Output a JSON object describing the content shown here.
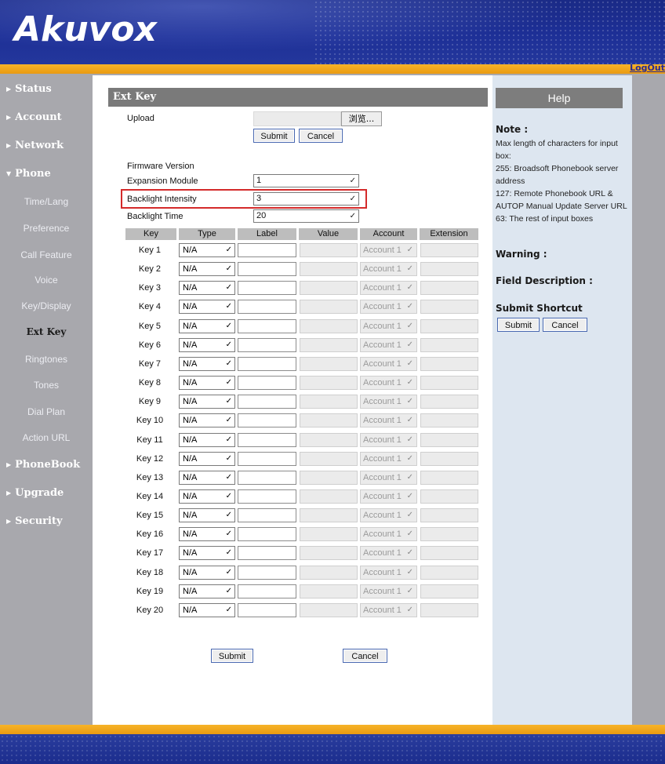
{
  "header": {
    "logo": "Akuvox",
    "logout": "LogOut"
  },
  "sidebar": {
    "sections": [
      {
        "label": "Status"
      },
      {
        "label": "Account"
      },
      {
        "label": "Network"
      },
      {
        "label": "Phone"
      },
      {
        "label": "PhoneBook"
      },
      {
        "label": "Upgrade"
      },
      {
        "label": "Security"
      }
    ],
    "phone_items": [
      {
        "label": "Time/Lang"
      },
      {
        "label": "Preference"
      },
      {
        "label": "Call Feature"
      },
      {
        "label": "Voice"
      },
      {
        "label": "Key/Display"
      },
      {
        "label": "Ext Key"
      },
      {
        "label": "Ringtones"
      },
      {
        "label": "Tones"
      },
      {
        "label": "Dial Plan"
      },
      {
        "label": "Action URL"
      }
    ],
    "active": "Ext Key"
  },
  "main": {
    "title": "Ext Key",
    "upload": {
      "label": "Upload",
      "browse": "浏览...",
      "submit": "Submit",
      "cancel": "Cancel"
    },
    "firmware_label": "Firmware Version",
    "expansion_module": {
      "label": "Expansion Module",
      "value": "1"
    },
    "backlight_intensity": {
      "label": "Backlight Intensity",
      "value": "3"
    },
    "backlight_time": {
      "label": "Backlight Time",
      "value": "20"
    },
    "table": {
      "headers": [
        "Key",
        "Type",
        "Label",
        "Value",
        "Account",
        "Extension"
      ],
      "rows": [
        {
          "key": "Key 1",
          "type": "N/A",
          "account": "Account 1"
        },
        {
          "key": "Key 2",
          "type": "N/A",
          "account": "Account 1"
        },
        {
          "key": "Key 3",
          "type": "N/A",
          "account": "Account 1"
        },
        {
          "key": "Key 4",
          "type": "N/A",
          "account": "Account 1"
        },
        {
          "key": "Key 5",
          "type": "N/A",
          "account": "Account 1"
        },
        {
          "key": "Key 6",
          "type": "N/A",
          "account": "Account 1"
        },
        {
          "key": "Key 7",
          "type": "N/A",
          "account": "Account 1"
        },
        {
          "key": "Key 8",
          "type": "N/A",
          "account": "Account 1"
        },
        {
          "key": "Key 9",
          "type": "N/A",
          "account": "Account 1"
        },
        {
          "key": "Key 10",
          "type": "N/A",
          "account": "Account 1"
        },
        {
          "key": "Key 11",
          "type": "N/A",
          "account": "Account 1"
        },
        {
          "key": "Key 12",
          "type": "N/A",
          "account": "Account 1"
        },
        {
          "key": "Key 13",
          "type": "N/A",
          "account": "Account 1"
        },
        {
          "key": "Key 14",
          "type": "N/A",
          "account": "Account 1"
        },
        {
          "key": "Key 15",
          "type": "N/A",
          "account": "Account 1"
        },
        {
          "key": "Key 16",
          "type": "N/A",
          "account": "Account 1"
        },
        {
          "key": "Key 17",
          "type": "N/A",
          "account": "Account 1"
        },
        {
          "key": "Key 18",
          "type": "N/A",
          "account": "Account 1"
        },
        {
          "key": "Key 19",
          "type": "N/A",
          "account": "Account 1"
        },
        {
          "key": "Key 20",
          "type": "N/A",
          "account": "Account 1"
        }
      ]
    },
    "submit": "Submit",
    "cancel": "Cancel"
  },
  "help": {
    "title": "Help",
    "note_title": "Note :",
    "note_lines": [
      "Max length of characters for input box:",
      "255: Broadsoft Phonebook server address",
      "127: Remote Phonebook URL & AUTOP Manual Update Server URL",
      "63: The rest of input boxes"
    ],
    "warning_title": "Warning :",
    "field_description_title": "Field Description :",
    "shortcut_title": "Submit Shortcut",
    "submit": "Submit",
    "cancel": "Cancel"
  },
  "colors": {
    "header_blue": "#1d2f96",
    "orange": "#f0a71d",
    "sidebar_gray": "#a8a8ad",
    "highlight_red": "#d42b2b",
    "help_bg": "#dde6f0"
  }
}
